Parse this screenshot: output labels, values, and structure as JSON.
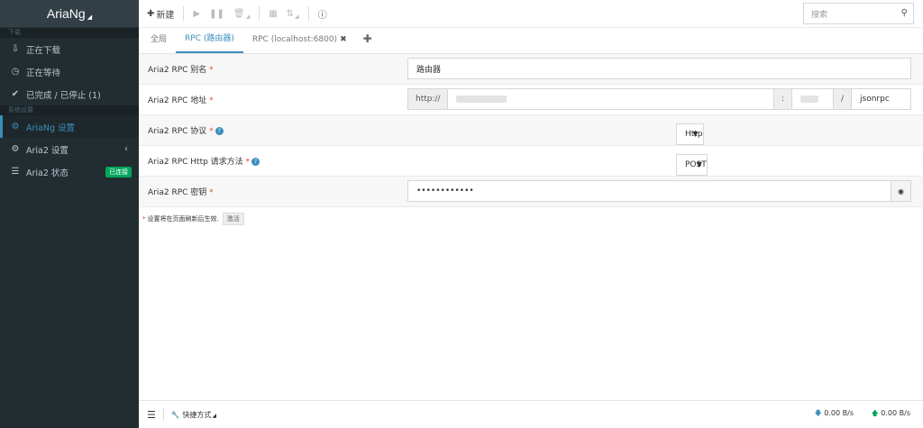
{
  "brand": {
    "name": "AriaNg"
  },
  "sidebar": {
    "section_downloads": "下载",
    "downloading": "正在下载",
    "waiting": "正在等待",
    "stopped": "已完成 / 已停止 (1)",
    "section_settings": "系统设置",
    "ariang_settings": "AriaNg 设置",
    "aria2_settings": "Aria2 设置",
    "aria2_status": "Aria2 状态",
    "aria2_status_badge": "已连接"
  },
  "toolbar": {
    "new_label": "新建",
    "search_placeholder": "搜索"
  },
  "tabs": {
    "global": "全局",
    "rpc_router": "RPC (路由器)",
    "rpc_local": "RPC (localhost:6800)"
  },
  "form": {
    "alias_label": "Aria2 RPC 别名",
    "alias_value": "路由器",
    "address_label": "Aria2 RPC 地址",
    "address_protocol_prefix": "http://",
    "address_port_sep": ":",
    "address_path_sep": "/",
    "address_path": "jsonrpc",
    "protocol_label": "Aria2 RPC 协议",
    "protocol_value": "Http",
    "method_label": "Aria2 RPC Http 请求方法",
    "method_value": "POST",
    "secret_label": "Aria2 RPC 密钥",
    "secret_value": "••••••••••••",
    "required_mark": "*"
  },
  "note": {
    "text": "设置将在页面刷新后生效.",
    "activate": "激活"
  },
  "footer": {
    "shortcut": "快捷方式",
    "download_speed": "0.00 B/s",
    "upload_speed": "0.00 B/s"
  },
  "colors": {
    "accent": "#3c8dbc",
    "sidebar_bg": "#222d32",
    "success": "#00a65a",
    "required": "#dd4b39"
  }
}
